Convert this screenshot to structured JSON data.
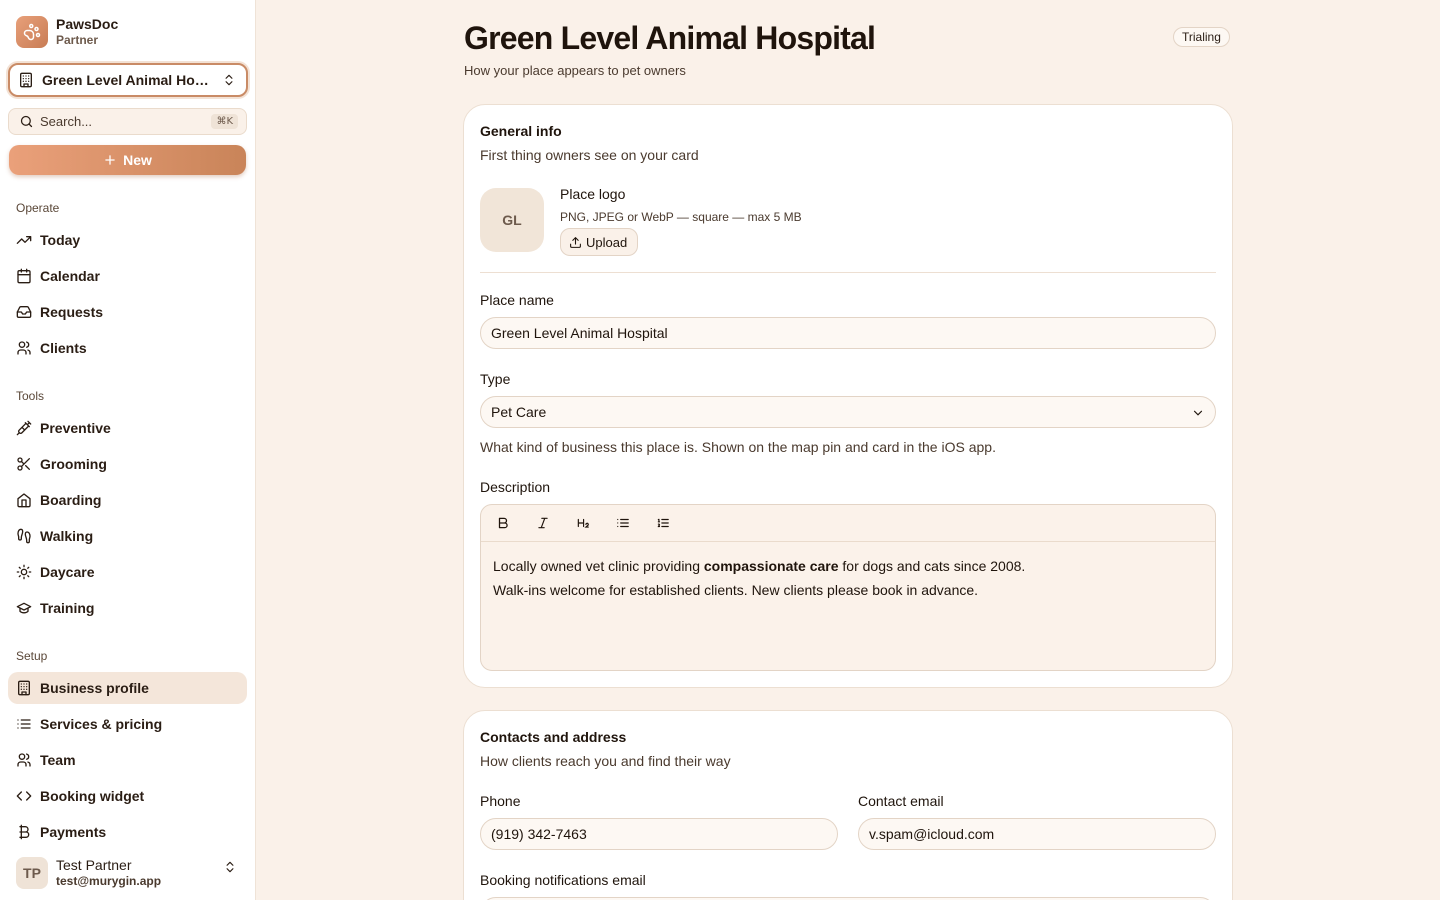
{
  "brand": {
    "name": "PawsDoc",
    "subtitle": "Partner"
  },
  "place_selector": {
    "label": "Green Level Animal Hospital"
  },
  "search": {
    "placeholder": "Search...",
    "shortcut": "⌘K"
  },
  "new_button": {
    "label": "New"
  },
  "sections": {
    "operate": "Operate",
    "tools": "Tools",
    "setup": "Setup"
  },
  "nav": {
    "operate": [
      {
        "label": "Today",
        "icon": "trending-up-icon"
      },
      {
        "label": "Calendar",
        "icon": "calendar-icon"
      },
      {
        "label": "Requests",
        "icon": "inbox-icon"
      },
      {
        "label": "Clients",
        "icon": "users-icon"
      }
    ],
    "tools": [
      {
        "label": "Preventive",
        "icon": "syringe-icon"
      },
      {
        "label": "Grooming",
        "icon": "scissors-icon"
      },
      {
        "label": "Boarding",
        "icon": "home-icon"
      },
      {
        "label": "Walking",
        "icon": "footprints-icon"
      },
      {
        "label": "Daycare",
        "icon": "sun-icon"
      },
      {
        "label": "Training",
        "icon": "graduation-cap-icon"
      }
    ],
    "setup": [
      {
        "label": "Business profile",
        "icon": "building-icon",
        "active": true
      },
      {
        "label": "Services & pricing",
        "icon": "list-icon"
      },
      {
        "label": "Team",
        "icon": "users-icon"
      },
      {
        "label": "Booking widget",
        "icon": "code-icon"
      },
      {
        "label": "Payments",
        "icon": "currency-icon"
      }
    ]
  },
  "user": {
    "initials": "TP",
    "name": "Test Partner",
    "email": "test@murygin.app"
  },
  "page": {
    "title": "Green Level Animal Hospital",
    "subtitle": "How your place appears to pet owners",
    "status_badge": "Trialing"
  },
  "general_info": {
    "title": "General info",
    "subtitle": "First thing owners see on your card",
    "logo_initials": "GL",
    "logo_title": "Place logo",
    "logo_hint": "PNG, JPEG or WebP — square — max 5 MB",
    "upload_label": "Upload",
    "place_name_label": "Place name",
    "place_name_value": "Green Level Animal Hospital",
    "type_label": "Type",
    "type_value": "Pet Care",
    "type_hint": "What kind of business this place is. Shown on the map pin and card in the iOS app.",
    "description_label": "Description",
    "description": {
      "line1_before": "Locally owned vet clinic providing ",
      "line1_bold": "compassionate care",
      "line1_after": " for dogs and cats since 2008.",
      "line2": "Walk-ins welcome for established clients. New clients please book in advance."
    }
  },
  "contacts": {
    "title": "Contacts and address",
    "subtitle": "How clients reach you and find their way",
    "phone_label": "Phone",
    "phone_value": "(919) 342-7463",
    "email_label": "Contact email",
    "email_value": "v.spam@icloud.com",
    "booking_email_label": "Booking notifications email"
  },
  "colors": {
    "accent": "#d08a60",
    "background": "#faf1e9",
    "active_nav": "#f4e6da"
  }
}
